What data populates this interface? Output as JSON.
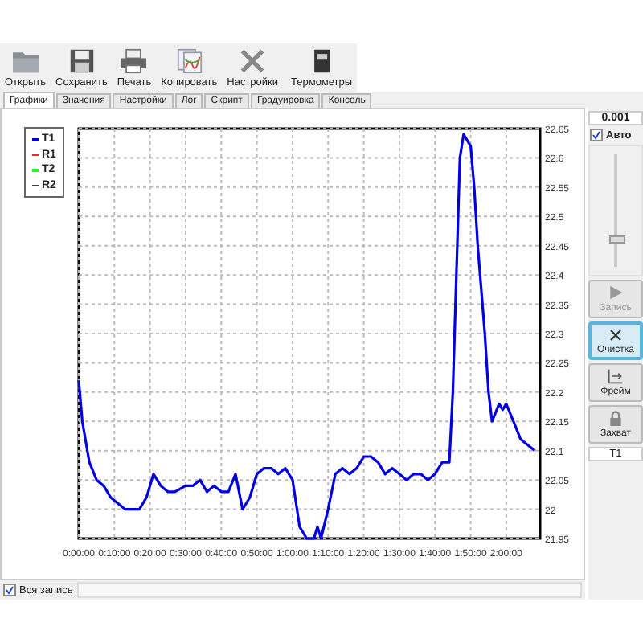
{
  "toolbar": [
    {
      "label": "Открыть"
    },
    {
      "label": "Сохранить"
    },
    {
      "label": "Печать"
    },
    {
      "label": "Копировать"
    },
    {
      "label": "Настройки"
    },
    {
      "label": "Термометры"
    }
  ],
  "tabs": [
    {
      "label": "Графики",
      "selected": true
    },
    {
      "label": "Значения",
      "selected": false
    },
    {
      "label": "Настройки",
      "selected": false
    },
    {
      "label": "Лог",
      "selected": false
    },
    {
      "label": "Скрипт",
      "selected": false
    },
    {
      "label": "Градуировка",
      "selected": false
    },
    {
      "label": "Консоль",
      "selected": false
    }
  ],
  "chart_data": {
    "type": "line",
    "grid": true,
    "xlim": [
      0,
      129.5
    ],
    "ylim": [
      21.95,
      22.65
    ],
    "xticks": [
      {
        "value": 0,
        "label": "0:00:00"
      },
      {
        "value": 10,
        "label": "0:10:00"
      },
      {
        "value": 20,
        "label": "0:20:00"
      },
      {
        "value": 30,
        "label": "0:30:00"
      },
      {
        "value": 40,
        "label": "0:40:00"
      },
      {
        "value": 50,
        "label": "0:50:00"
      },
      {
        "value": 60,
        "label": "1:00:00"
      },
      {
        "value": 70,
        "label": "1:10:00"
      },
      {
        "value": 80,
        "label": "1:20:00"
      },
      {
        "value": 90,
        "label": "1:30:00"
      },
      {
        "value": 100,
        "label": "1:40:00"
      },
      {
        "value": 110,
        "label": "1:50:00"
      },
      {
        "value": 120,
        "label": "2:00:00"
      }
    ],
    "yticks": [
      21.95,
      22,
      22.05,
      22.1,
      22.15,
      22.2,
      22.25,
      22.3,
      22.35,
      22.4,
      22.45,
      22.5,
      22.55,
      22.6,
      22.65
    ],
    "x": [
      0,
      1,
      3,
      5,
      7,
      9,
      11,
      13,
      15,
      17,
      19,
      21,
      23,
      25,
      27,
      30,
      32,
      34,
      36,
      38,
      40,
      42,
      44,
      46,
      48,
      50,
      52,
      54,
      56,
      58,
      60,
      62,
      64,
      66,
      67,
      68,
      70,
      72,
      74,
      76,
      78,
      80,
      82,
      84,
      86,
      88,
      90,
      92,
      94,
      96,
      98,
      100,
      102,
      104,
      105,
      106,
      107,
      108,
      110,
      111,
      112,
      114,
      115,
      116,
      118,
      119,
      120,
      122,
      124,
      126,
      128
    ],
    "series": [
      {
        "name": "T1",
        "color": "#0000e0",
        "values": [
          22.22,
          22.15,
          22.08,
          22.05,
          22.04,
          22.02,
          22.01,
          22.0,
          22.0,
          22.0,
          22.02,
          22.06,
          22.04,
          22.03,
          22.03,
          22.04,
          22.04,
          22.05,
          22.03,
          22.04,
          22.03,
          22.03,
          22.06,
          22.0,
          22.02,
          22.06,
          22.07,
          22.07,
          22.06,
          22.07,
          22.05,
          21.97,
          21.95,
          21.95,
          21.97,
          21.95,
          22.0,
          22.06,
          22.07,
          22.06,
          22.07,
          22.09,
          22.09,
          22.08,
          22.06,
          22.07,
          22.06,
          22.05,
          22.06,
          22.06,
          22.05,
          22.06,
          22.08,
          22.08,
          22.2,
          22.4,
          22.6,
          22.64,
          22.62,
          22.55,
          22.45,
          22.3,
          22.2,
          22.15,
          22.18,
          22.17,
          22.18,
          22.15,
          22.12,
          22.11,
          22.1
        ]
      },
      {
        "name": "R1",
        "color": "#ff2020",
        "values": [
          null,
          null,
          null,
          null,
          null,
          null,
          null,
          null,
          null,
          null,
          null,
          null,
          null,
          null,
          null,
          null,
          null,
          null,
          null,
          null,
          null,
          null,
          null,
          null,
          null,
          null,
          null,
          null,
          null,
          null,
          null,
          null,
          null,
          null,
          null,
          null,
          null,
          null,
          null,
          null,
          null,
          null,
          null,
          null,
          null,
          null,
          null,
          null,
          null,
          null,
          null,
          null,
          null,
          null,
          null,
          null,
          null,
          null,
          null,
          null,
          null,
          null,
          null,
          null,
          null,
          null,
          null,
          null,
          null,
          null,
          null
        ]
      },
      {
        "name": "T2",
        "color": "#20ff20",
        "values": [
          null,
          null,
          null,
          null,
          null,
          null,
          null,
          null,
          null,
          null,
          null,
          null,
          null,
          null,
          null,
          null,
          null,
          null,
          null,
          null,
          null,
          null,
          null,
          null,
          null,
          null,
          null,
          null,
          null,
          null,
          null,
          null,
          null,
          null,
          null,
          null,
          null,
          null,
          null,
          null,
          null,
          null,
          null,
          null,
          null,
          null,
          null,
          null,
          null,
          null,
          null,
          null,
          null,
          null,
          null,
          null,
          null,
          null,
          null,
          null,
          null,
          null,
          null,
          null,
          null,
          null,
          null,
          null,
          null,
          null,
          null
        ]
      },
      {
        "name": "R2",
        "color": "#404040",
        "values": [
          null,
          null,
          null,
          null,
          null,
          null,
          null,
          null,
          null,
          null,
          null,
          null,
          null,
          null,
          null,
          null,
          null,
          null,
          null,
          null,
          null,
          null,
          null,
          null,
          null,
          null,
          null,
          null,
          null,
          null,
          null,
          null,
          null,
          null,
          null,
          null,
          null,
          null,
          null,
          null,
          null,
          null,
          null,
          null,
          null,
          null,
          null,
          null,
          null,
          null,
          null,
          null,
          null,
          null,
          null,
          null,
          null,
          null,
          null,
          null,
          null,
          null,
          null,
          null,
          null,
          null,
          null,
          null,
          null,
          null,
          null
        ]
      }
    ]
  },
  "side": {
    "reading": "0.001",
    "auto": {
      "label": "Авто",
      "checked": true
    },
    "slider": {
      "level": 0.25
    },
    "buttons": [
      {
        "label": "Запись",
        "disabled": true,
        "selected": false
      },
      {
        "label": "Очистка",
        "disabled": false,
        "selected": true
      },
      {
        "label": "Фрейм",
        "disabled": false,
        "selected": false
      },
      {
        "label": "Захват",
        "disabled": false,
        "selected": false
      }
    ],
    "channel": "T1"
  },
  "bottom": {
    "all_records": {
      "label": "Вся запись",
      "checked": true
    }
  }
}
